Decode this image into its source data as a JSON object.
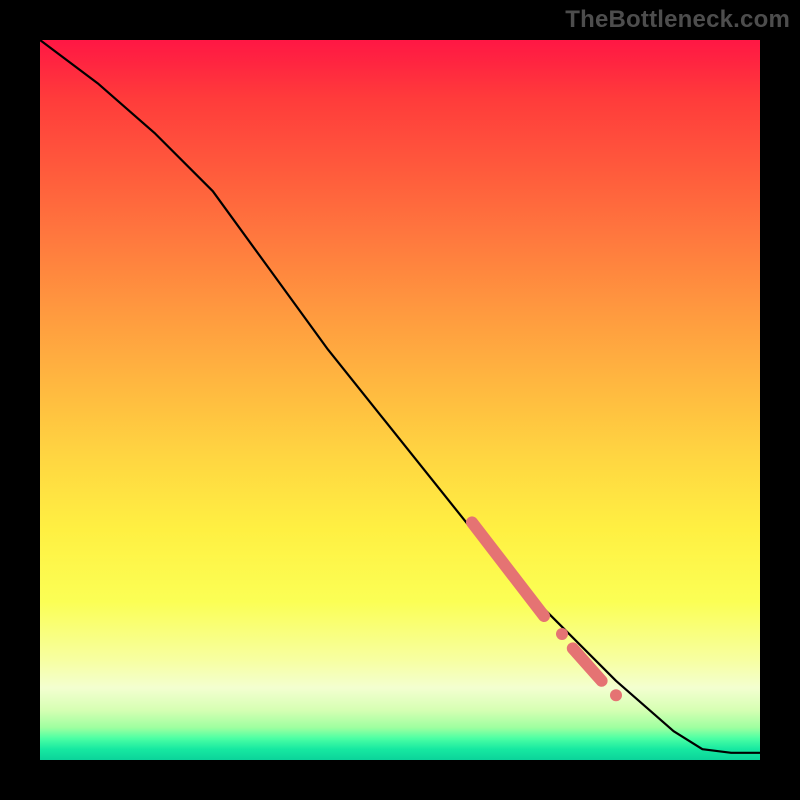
{
  "watermark": "TheBottleneck.com",
  "colors": {
    "highlight": "#e57373",
    "curve": "#000000",
    "frame": "#000000"
  },
  "chart_data": {
    "type": "line",
    "title": "",
    "xlabel": "",
    "ylabel": "",
    "xlim": [
      0,
      100
    ],
    "ylim": [
      0,
      100
    ],
    "series": [
      {
        "name": "curve",
        "x": [
          0,
          8,
          16,
          24,
          32,
          40,
          48,
          56,
          64,
          72,
          80,
          88,
          92,
          96,
          100
        ],
        "y": [
          100,
          94,
          87,
          79,
          68,
          57,
          47,
          37,
          27,
          19,
          11,
          4,
          1.5,
          1,
          1
        ]
      }
    ],
    "highlights": [
      {
        "type": "segment",
        "x0": 60,
        "y0": 33,
        "x1": 70,
        "y1": 20
      },
      {
        "type": "dot",
        "x": 72.5,
        "y": 17.5
      },
      {
        "type": "segment",
        "x0": 74,
        "y0": 15.5,
        "x1": 78,
        "y1": 11
      },
      {
        "type": "dot",
        "x": 80,
        "y": 9
      }
    ]
  }
}
